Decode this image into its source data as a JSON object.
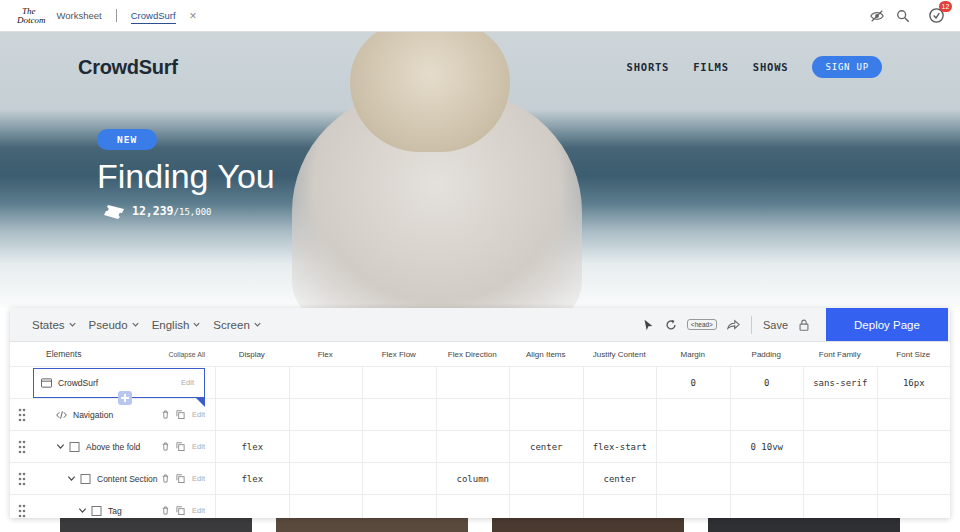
{
  "browser": {
    "logo": [
      "The",
      "Dotcom"
    ],
    "tabs": [
      {
        "label": "Worksheet",
        "selected": false,
        "close": ""
      },
      {
        "label": "CrowdSurf",
        "selected": true,
        "close": "×"
      }
    ],
    "notifications": "12"
  },
  "hero": {
    "brand": "CrowdSurf",
    "nav": [
      "SHORTS",
      "FILMS",
      "SHOWS"
    ],
    "cta": "SIGN UP",
    "badge": "NEW",
    "title": "Finding You",
    "count": "12,239",
    "total": "/15,000"
  },
  "editor": {
    "menus": [
      "States",
      "Pseudo",
      "English",
      "Screen"
    ],
    "head_tag": "<head>",
    "save": "Save",
    "deploy": "Deploy Page",
    "elements_label": "Elements",
    "collapse": "Collapse All",
    "columns": [
      "Display",
      "Flex",
      "Flex Flow",
      "Flex Direction",
      "Align Items",
      "Justify Content",
      "Margin",
      "Padding",
      "Font Family",
      "Font Size"
    ],
    "elements": [
      {
        "name": "CrowdSurf",
        "kind": "root",
        "depth": 0,
        "selected": true,
        "action": "Edit",
        "values": [
          "",
          "",
          "",
          "",
          "",
          "",
          "0",
          "0",
          "sans-serif",
          "16px"
        ]
      },
      {
        "name": "Navigation",
        "kind": "code",
        "depth": 1,
        "selected": false,
        "action": "Edit",
        "values": [
          "",
          "",
          "",
          "",
          "",
          "",
          "",
          "",
          "",
          ""
        ]
      },
      {
        "name": "Above the fold",
        "kind": "box",
        "depth": 1,
        "expanded": true,
        "selected": false,
        "action": "Edit",
        "values": [
          "flex",
          "",
          "",
          "",
          "center",
          "flex-start",
          "",
          "0 10vw",
          "",
          ""
        ]
      },
      {
        "name": "Content Section",
        "kind": "box",
        "depth": 2,
        "expanded": true,
        "selected": false,
        "action": "Edit",
        "values": [
          "flex",
          "",
          "",
          "column",
          "",
          "center",
          "",
          "",
          "",
          ""
        ]
      },
      {
        "name": "Tag",
        "kind": "box",
        "depth": 3,
        "expanded": true,
        "selected": false,
        "action": "Edit",
        "values": [
          "",
          "",
          "",
          "",
          "",
          "",
          "",
          "",
          "",
          ""
        ]
      }
    ]
  }
}
